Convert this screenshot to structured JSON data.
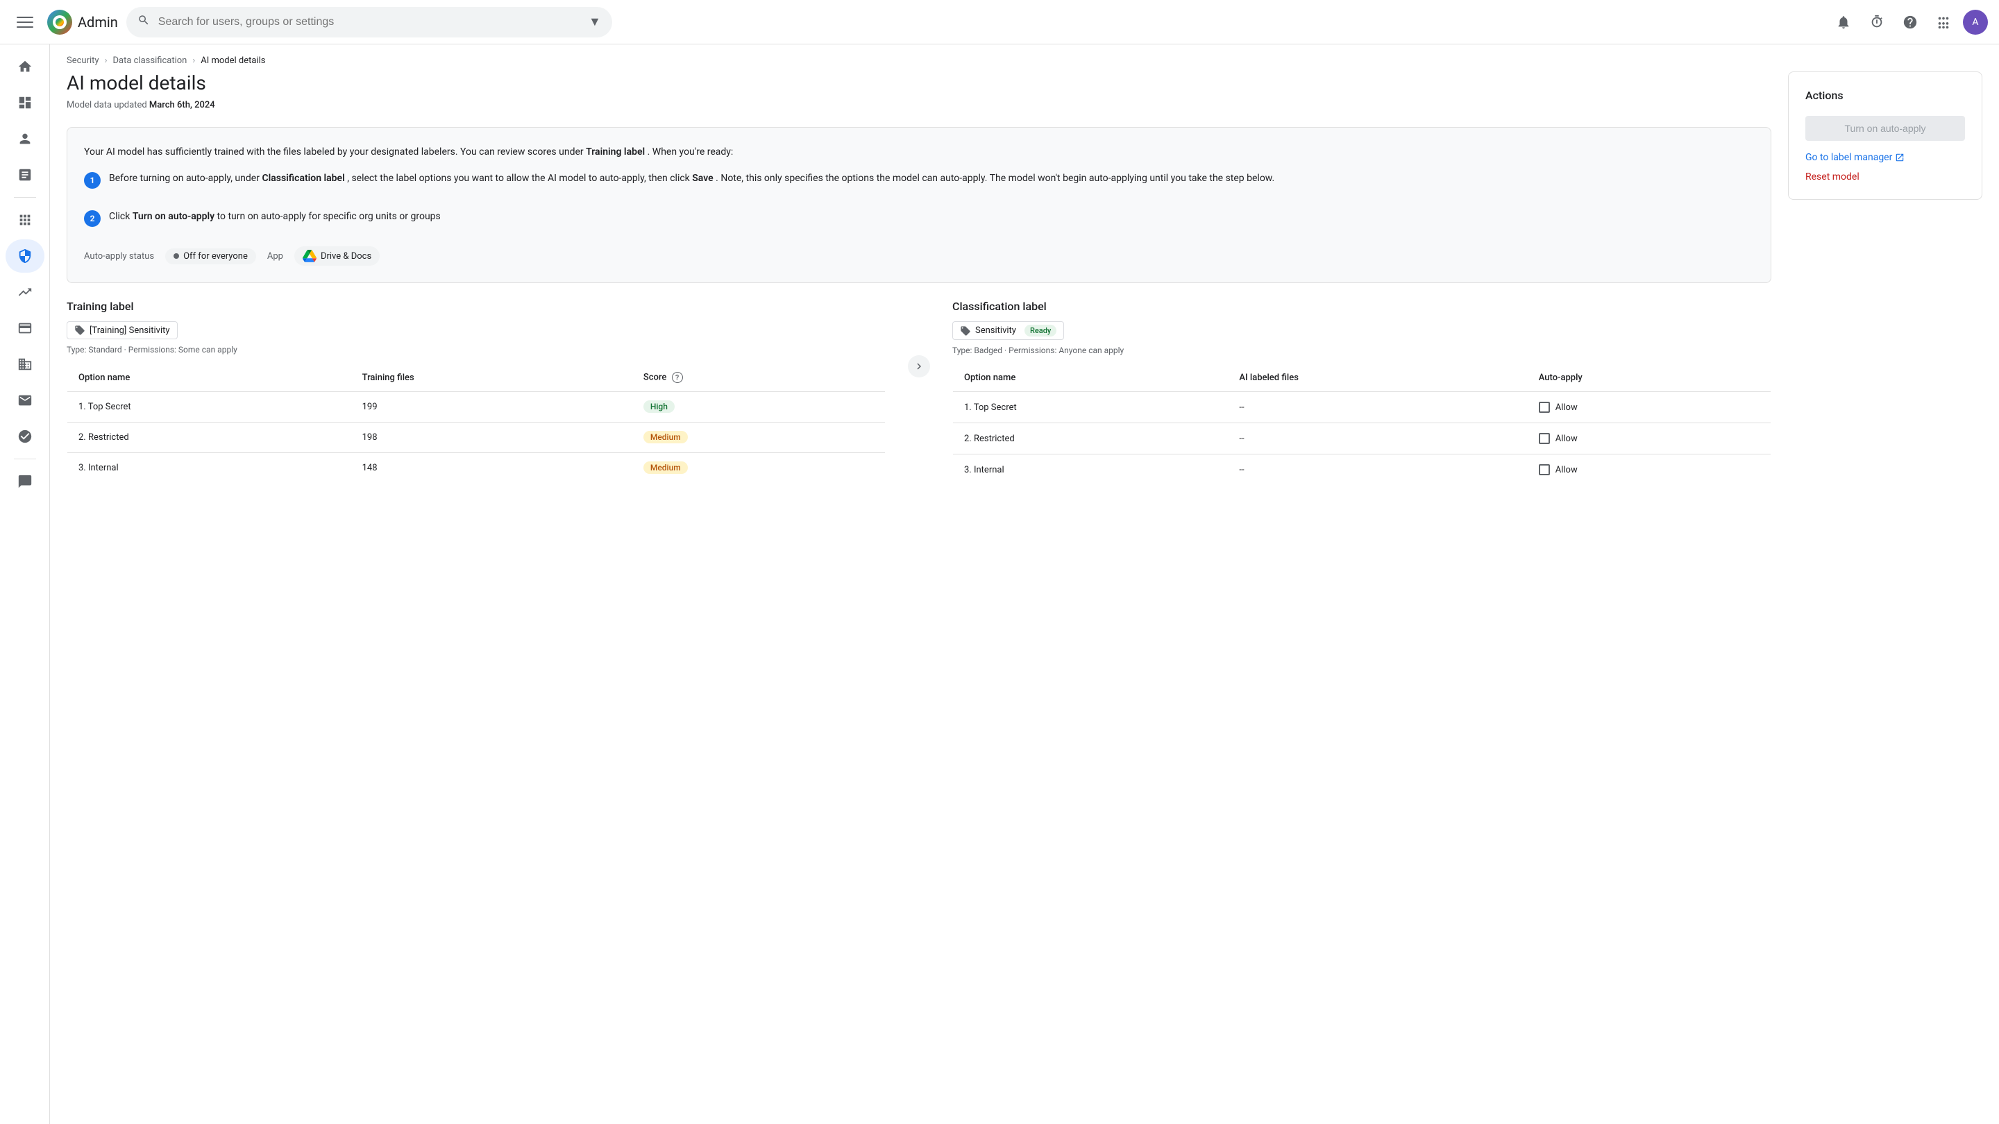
{
  "topbar": {
    "menu_label": "☰",
    "logo_text": "Admin",
    "search_placeholder": "Search for users, groups or settings"
  },
  "breadcrumb": {
    "items": [
      {
        "label": "Security",
        "href": "#"
      },
      {
        "label": "Data classification",
        "href": "#"
      },
      {
        "label": "AI model details",
        "href": "#",
        "current": true
      }
    ]
  },
  "page": {
    "title": "AI model details",
    "subtitle": "Model data updated",
    "subtitle_date": "March 6th, 2024",
    "info_text": "Your AI model has sufficiently trained with the files labeled by your designated labelers. You can review scores under",
    "info_bold": "Training label",
    "info_text2": ". When you're ready:",
    "step1_text": "Before turning on auto-apply, under",
    "step1_bold1": "Classification label",
    "step1_text2": ", select the label options you want to allow the AI model to auto-apply, then click",
    "step1_bold2": "Save",
    "step1_text3": ". Note, this only specifies the options the model can auto-apply. The model won't begin auto-applying until you take the step below.",
    "step2_text": "Click",
    "step2_bold": "Turn on auto-apply",
    "step2_text2": "to turn on auto-apply for specific org units or groups",
    "auto_apply_label": "Auto-apply status",
    "status_text": "Off for everyone",
    "app_label": "App",
    "app_text": "Drive & Docs"
  },
  "training_label": {
    "section_title": "Training label",
    "chip_text": "[Training] Sensitivity",
    "type_info": "Type: Standard · Permissions: Some can apply",
    "columns": [
      "Option name",
      "Training files",
      "Score"
    ],
    "rows": [
      {
        "name": "1. Top Secret",
        "files": "199",
        "score": "High",
        "score_type": "high"
      },
      {
        "name": "2. Restricted",
        "files": "198",
        "score": "Medium",
        "score_type": "medium"
      },
      {
        "name": "3. Internal",
        "files": "148",
        "score": "Medium",
        "score_type": "medium"
      }
    ]
  },
  "classification_label": {
    "section_title": "Classification label",
    "chip_text": "Sensitivity",
    "ready_badge": "Ready",
    "type_info": "Type: Badged · Permissions: Anyone can apply",
    "columns": [
      "Option name",
      "AI labeled files",
      "Auto-apply"
    ],
    "rows": [
      {
        "name": "1. Top Secret",
        "files": "--",
        "auto_apply": "Allow"
      },
      {
        "name": "2. Restricted",
        "files": "--",
        "auto_apply": "Allow"
      },
      {
        "name": "3. Internal",
        "files": "--",
        "auto_apply": "Allow"
      }
    ]
  },
  "actions": {
    "title": "Actions",
    "turn_on_label": "Turn on auto-apply",
    "go_to_label_manager": "Go to label manager",
    "reset_model": "Reset model"
  },
  "sidebar": {
    "items": [
      {
        "icon": "⊞",
        "name": "home",
        "active": false
      },
      {
        "icon": "▦",
        "name": "dashboard",
        "active": false
      },
      {
        "icon": "👤",
        "name": "users",
        "active": false
      },
      {
        "icon": "☰",
        "name": "reports",
        "active": false
      },
      {
        "icon": "⊞",
        "name": "apps",
        "active": false
      },
      {
        "icon": "🛡",
        "name": "security",
        "active": true
      },
      {
        "icon": "📊",
        "name": "analytics",
        "active": false
      },
      {
        "icon": "💳",
        "name": "billing",
        "active": false
      },
      {
        "icon": "🏢",
        "name": "directory",
        "active": false
      },
      {
        "icon": "✉",
        "name": "gmail",
        "active": false
      },
      {
        "icon": "⚙",
        "name": "settings",
        "active": false
      },
      {
        "icon": "💬",
        "name": "support",
        "active": false
      }
    ]
  }
}
